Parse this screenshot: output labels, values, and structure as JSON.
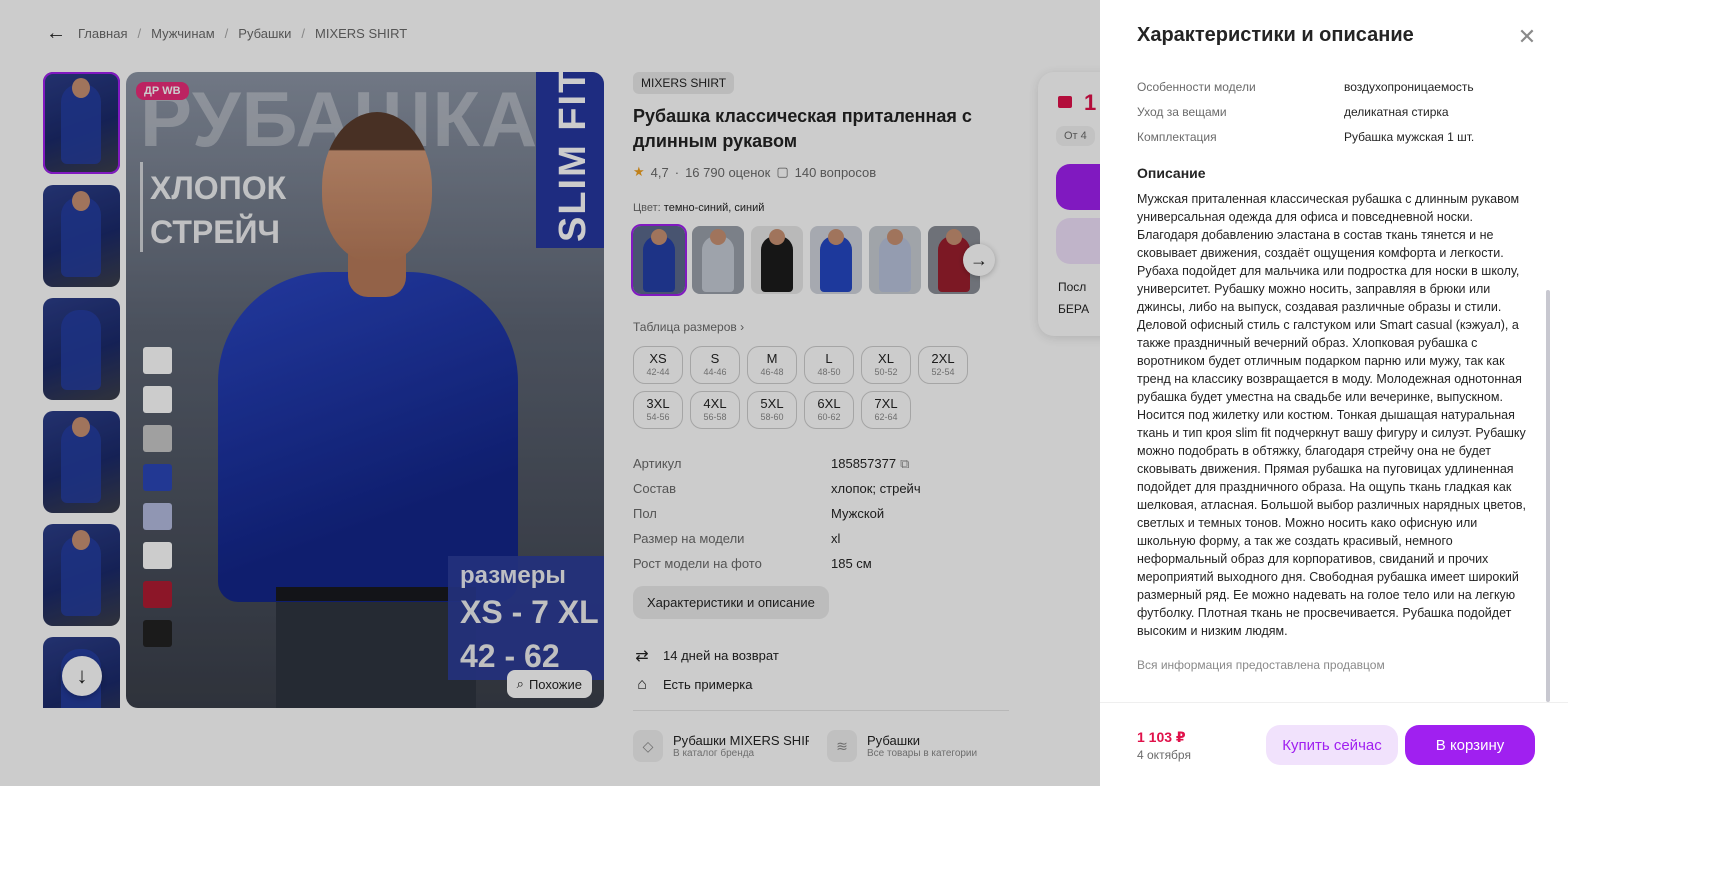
{
  "breadcrumbs": [
    "Главная",
    "Мужчинам",
    "Рубашки",
    "MIXERS SHIRT"
  ],
  "gallery": {
    "badge": "ДР WB",
    "overlay_word": "РУБАШКА",
    "claim_line1": "ХЛОПОК",
    "claim_line2": "СТРЕЙЧ",
    "fit": "SLIM FIT",
    "sizes_title": "размеры",
    "sizes_range": "XS - 7 XL",
    "sizes_numbers": "42 - 62",
    "similar_label": "Похожие",
    "swatch_colors": [
      "#ffffff",
      "#ffffff",
      "#c8c8c8",
      "#2b47b8",
      "#b4bce0",
      "#ffffff",
      "#b01c32",
      "#222222"
    ]
  },
  "product": {
    "brand": "MIXERS SHIRT",
    "title": "Рубашка классическая приталенная с длинным рукавом",
    "rating": "4,7",
    "reviews": "16 790 оценок",
    "questions": "140 вопросов",
    "color_label": "Цвет:",
    "color_value": "темно-синий, синий",
    "size_table_link": "Таблица размеров",
    "sizes": [
      {
        "s": "XS",
        "r": "42-44"
      },
      {
        "s": "S",
        "r": "44-46"
      },
      {
        "s": "M",
        "r": "46-48"
      },
      {
        "s": "L",
        "r": "48-50"
      },
      {
        "s": "XL",
        "r": "50-52"
      },
      {
        "s": "2XL",
        "r": "52-54"
      },
      {
        "s": "3XL",
        "r": "54-56"
      },
      {
        "s": "4XL",
        "r": "56-58"
      },
      {
        "s": "5XL",
        "r": "58-60"
      },
      {
        "s": "6XL",
        "r": "60-62"
      },
      {
        "s": "7XL",
        "r": "62-64"
      }
    ],
    "specs": [
      {
        "k": "Артикул",
        "v": "185857377"
      },
      {
        "k": "Состав",
        "v": "хлопок; стрейч"
      },
      {
        "k": "Пол",
        "v": "Мужской"
      },
      {
        "k": "Размер на модели",
        "v": "xl"
      },
      {
        "k": "Рост модели на фото",
        "v": "185 см"
      }
    ],
    "all_specs_button": "Характеристики и описание",
    "perks": [
      "14 дней на возврат",
      "Есть примерка"
    ],
    "links": [
      {
        "t1": "Рубашки MIXERS SHIRT",
        "t2": "В каталог бренда"
      },
      {
        "t1": "Рубашки",
        "t2": "Все товары в категории"
      }
    ]
  },
  "price_card": {
    "price_fragment": "1",
    "chip_fragment": "От 4",
    "line1_fragment": "Посл",
    "line2_fragment": "БЕРА"
  },
  "drawer": {
    "title": "Характеристики и описание",
    "features": [
      {
        "k": "Особенности модели",
        "v": "воздухопроницаемость"
      },
      {
        "k": "Уход за вещами",
        "v": "деликатная стирка"
      },
      {
        "k": "Комплектация",
        "v": "Рубашка мужская 1 шт."
      }
    ],
    "description_heading": "Описание",
    "description": "Мужская приталенная классическая рубашка с длинным рукавом универсальная одежда для офиса и повседневной носки. Благодаря добавлению эластана в состав ткань тянется и не сковывает движения, создаёт ощущения комфорта и легкости. Рубаха подойдет для мальчика или подростка для носки в школу, университет. Рубашку можно носить, заправляя в брюки или джинсы, либо на выпуск, создавая различные образы и стили. Деловой офисный стиль с галстуком или Smart casual (кэжуал), а также праздничный вечерний образ. Хлопковая рубашка с воротником будет отличным подарком парню или мужу, так как тренд на классику возвращается в моду. Молодежная однотонная рубашка будет уместна на свадьбе или вечеринке, выпускном. Носится под жилетку или костюм. Тонкая дышащая натуральная ткань и тип кроя slim fit подчеркнут вашу фигуру и силуэт. Рубашку можно подобрать в обтяжку, благодаря стрейчу она не будет сковывать движения. Прямая рубашка на пуговицах удлиненная подойдет для праздничного образа. На ощупь ткань гладкая как шелковая, атласная. Большой выбор различных нарядных цветов, светлых и темных тонов. Можно носить како офисную или школьную форму, а так же создать красивый, немного неформальный образ для корпоративов, свиданий и прочих мероприятий выходного дня. Свободная рубашка имеет широкий размерный ряд. Ее можно надевать на голое тело или на легкую футболку. Плотная ткань не просвечивается. Рубашка подойдет высоким и низким людям.",
    "vendor_note": "Вся информация предоставлена продавцом",
    "footer": {
      "price": "1 103 ₽",
      "date": "4 октября",
      "buy_now": "Купить сейчас",
      "add_to_cart": "В корзину"
    }
  },
  "colors": {
    "accent": "#a020f0",
    "price": "#e0114a",
    "accent_light": "#f1e2fc"
  }
}
